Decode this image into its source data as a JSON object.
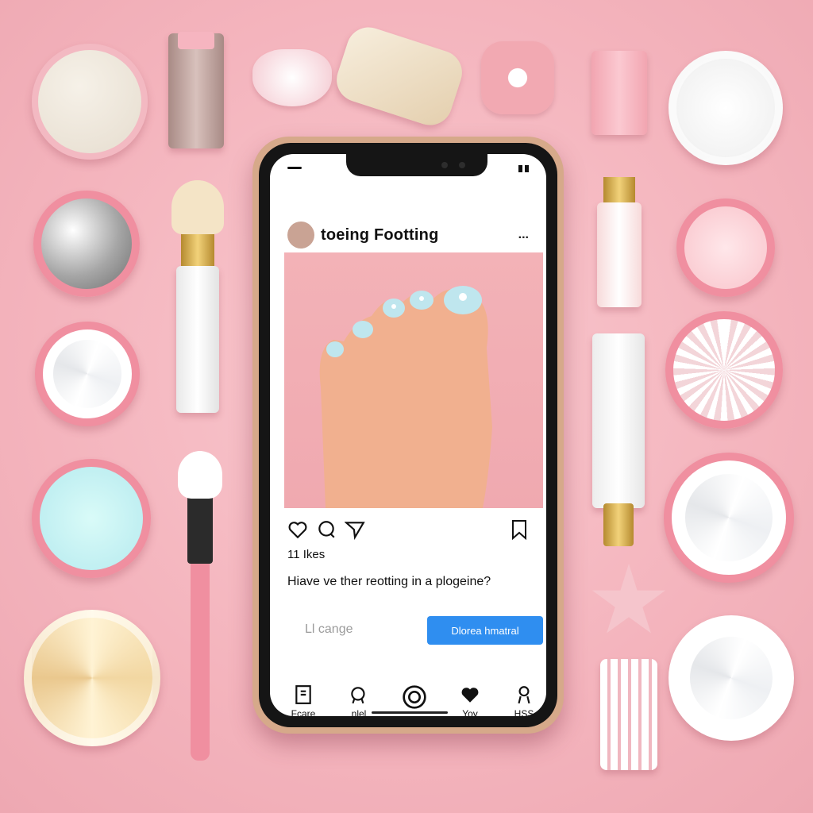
{
  "post": {
    "username": "toeing Footting",
    "more_label": "...",
    "likes": "11 Ikes",
    "caption": "Hiave ve ther reotting in a plogeine?",
    "comments_label": "Ll cange",
    "cta_label": "Dlorea hmatral"
  },
  "nav": {
    "items": [
      {
        "label": "Fcare",
        "icon": "home-square-icon"
      },
      {
        "label": "nlel",
        "icon": "search-icon"
      },
      {
        "label": "",
        "icon": "reels-circle-icon"
      },
      {
        "label": "Yoy",
        "icon": "heart-icon"
      },
      {
        "label": "HSS",
        "icon": "profile-icon"
      }
    ]
  },
  "colors": {
    "background": "#f4b4bd",
    "cta": "#2f8ef0",
    "nail_polish": "#bfe6ee",
    "skin": "#f1b08f"
  }
}
